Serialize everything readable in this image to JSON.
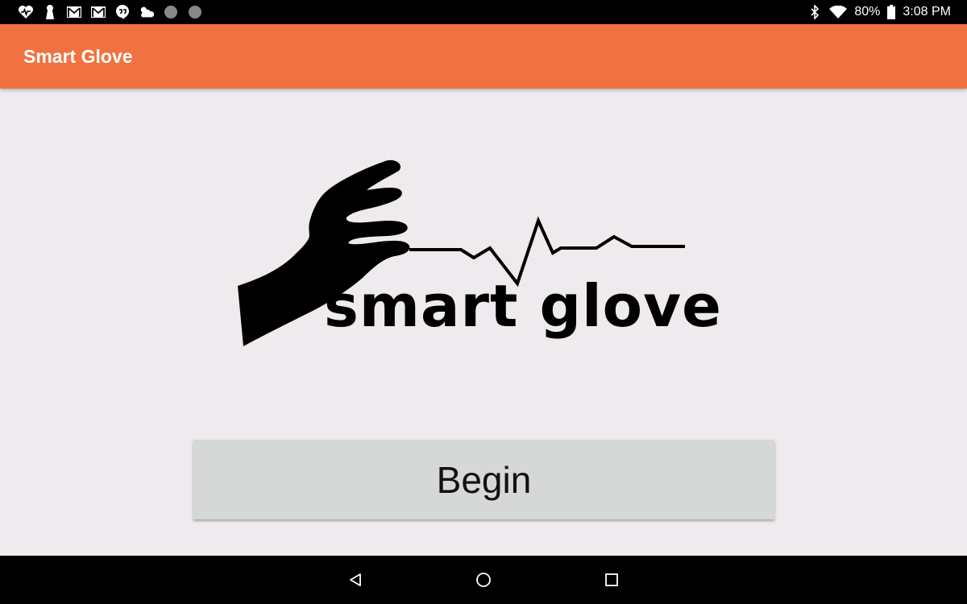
{
  "status_bar": {
    "notification_icons": [
      "heartbeat-icon",
      "keyhole-icon",
      "gmail-icon",
      "gmail-icon",
      "hangouts-icon",
      "weather-icon",
      "dot-icon",
      "dot-icon"
    ],
    "system_icons": [
      "bluetooth-icon",
      "wifi-icon",
      "battery-icon"
    ],
    "battery": "80%",
    "time": "3:08 PM"
  },
  "app_bar": {
    "title": "Smart Glove",
    "color": "#f07241"
  },
  "logo": {
    "text": "smart glove",
    "icon": "hand-with-pulse-icon"
  },
  "begin_button": {
    "label": "Begin"
  },
  "nav_bar": {
    "buttons": [
      "back-icon",
      "home-icon",
      "recents-icon"
    ]
  }
}
